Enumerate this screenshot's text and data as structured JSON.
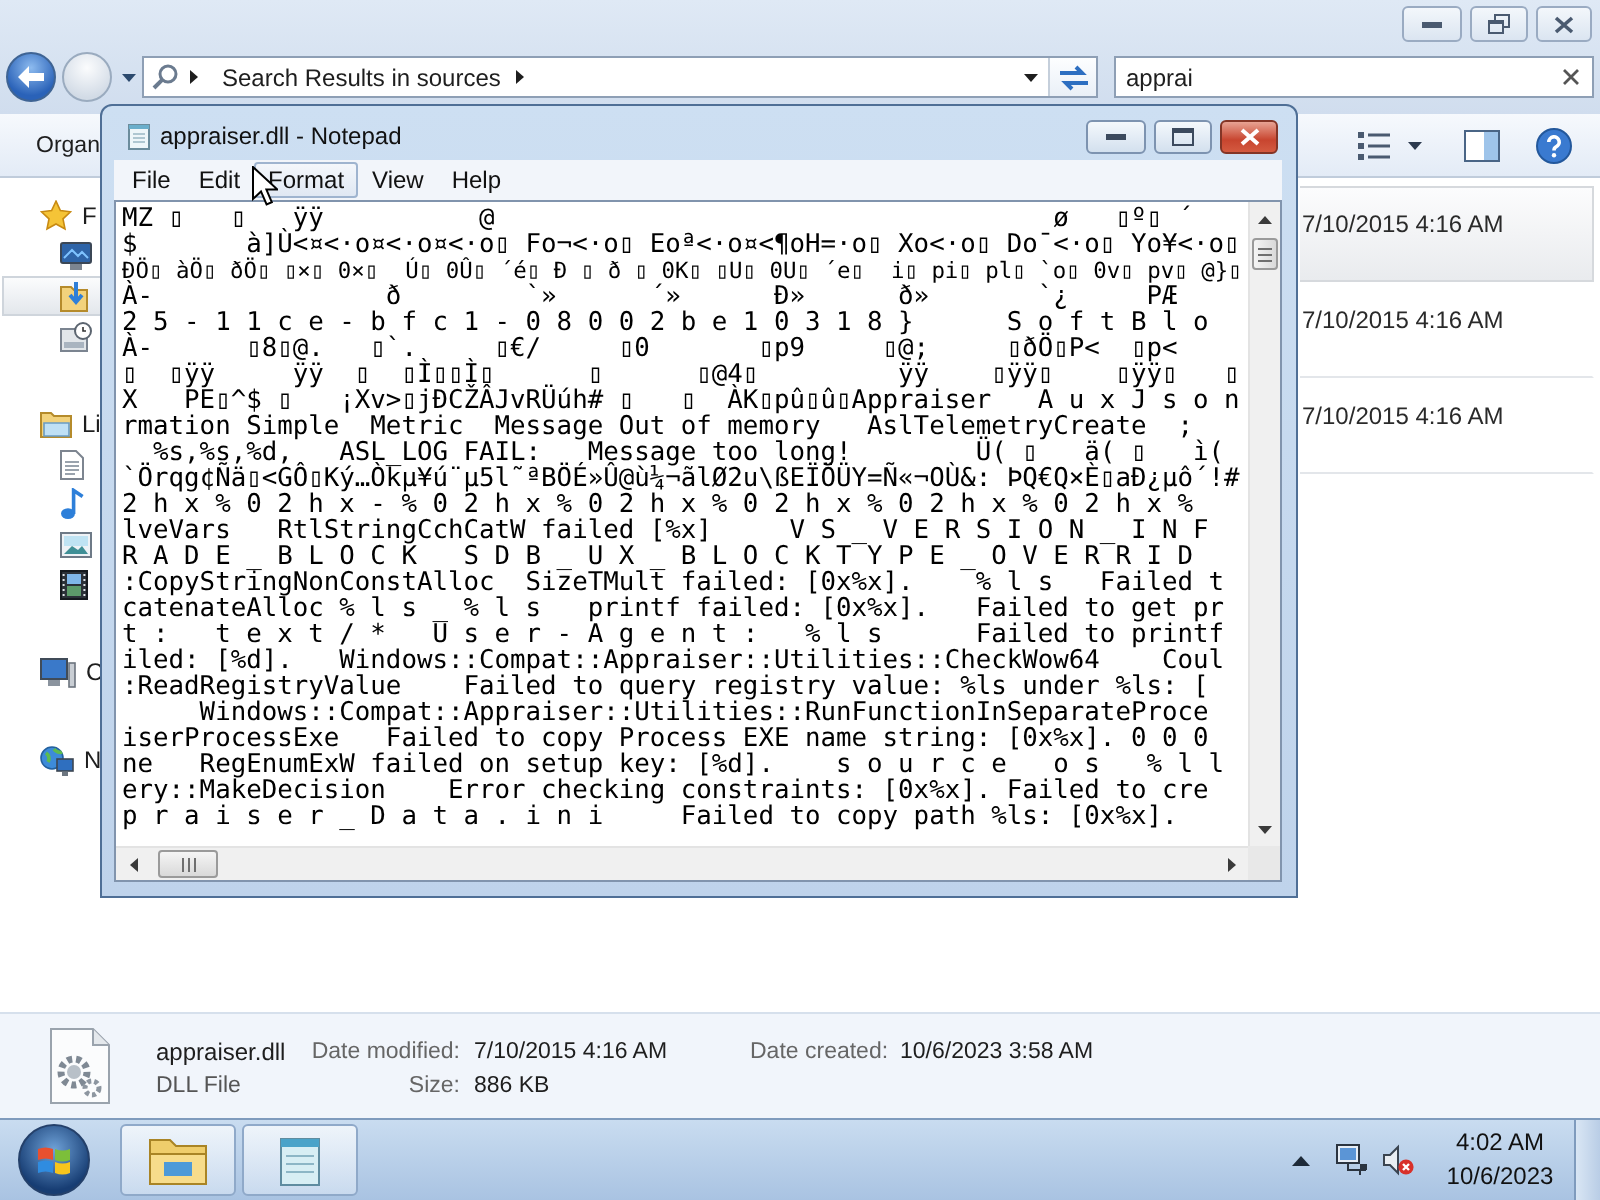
{
  "explorer": {
    "nav_buttons": [
      {
        "kind": "back",
        "disabled": false
      },
      {
        "kind": "forward",
        "disabled": true
      }
    ],
    "address_bar": {
      "path": "Search Results in sources"
    },
    "search": {
      "value": "apprai"
    },
    "toolbar": {
      "menu_label": "Organ"
    },
    "nav_pane": [
      {
        "label": "F",
        "selected": false,
        "children": [
          {
            "selected": false
          },
          {
            "selected": true
          },
          {
            "selected": false
          }
        ]
      },
      {
        "label": "Li",
        "selected": false,
        "children": [
          {
            "selected": false
          },
          {
            "selected": false
          },
          {
            "selected": false
          },
          {
            "selected": false
          }
        ]
      },
      {
        "label": "C",
        "selected": false
      },
      {
        "label": "N",
        "selected": false
      }
    ],
    "results": [
      {
        "date_modified": "7/10/2015 4:16 AM",
        "selected": true
      },
      {
        "date_modified": "7/10/2015 4:16 AM",
        "selected": false
      },
      {
        "date_modified": "7/10/2015 4:16 AM",
        "selected": false
      }
    ],
    "details_pane": {
      "name": "appraiser.dll",
      "type": "DLL File",
      "properties": [
        {
          "label": "Date modified:",
          "value": "7/10/2015 4:16 AM"
        },
        {
          "label": "Date created:",
          "value": "10/6/2023 3:58 AM"
        },
        {
          "label": "Size:",
          "value": "886 KB"
        }
      ]
    }
  },
  "notepad": {
    "title": "appraiser.dll - Notepad",
    "menu": [
      {
        "label": "File",
        "highlighted": false
      },
      {
        "label": "Edit",
        "highlighted": false
      },
      {
        "label": "Format",
        "highlighted": true
      },
      {
        "label": "View",
        "highlighted": false
      },
      {
        "label": "Help",
        "highlighted": false
      }
    ],
    "lines": [
      "MZ ▯   ▯   ÿÿ          @                                    ø   ▯º▯ ´",
      "$       à]Ù<¤<·o¤<·o¤<·o▯ Fo¬<·o▯ Eoª<·o¤<¶oH=·o▯ Xo<·o▯ Do¯<·o▯ Yo¥<·o▯",
      "ÐÖ▯ àÖ▯ ðÖ▯ ▯×▯ 0×▯  Ú▯ 0Û▯ ´é▯ Ð ▯ ð ▯ 0K▯ ▯U▯ 0U▯ ´e▯  i▯ pi▯ pl▯ `o▯ 0v▯ pv▯ @}▯",
      "À-               ð        `»      ´»      Ð»      ð»       `¿     PÆ",
      "2 5 - 1 1 c e - b f c 1 - 0 8 0 0 2 b e 1 0 3 1 8 }      S o f t B l o",
      "À-      ▯8▯@.   ▯`.     ▯€/     ▯0       ▯p9     ▯@;     ▯ðÖ▯P<  ▯p<",
      "▯  ▯ÿÿ     ÿÿ  ▯  ▯Ì▯▯Ì▯      ▯      ▯@4▯         ÿÿ    ▯ÿÿ▯    ▯ÿÿ▯   ▯",
      "X   PE▯^$ ▯   ¡Xv>▯jÐCŽÂJvRÜúh# ▯   ▯  ÀK▯pû▯û▯Appraiser   A u x J s o n",
      "rmation Simple  Metric  Message Out of memory   AslTelemetryCreate  ;",
      "  %s,%s,%d,   ASL_LOG FAIL:   Message too long!        Ü( ▯   ä( ▯   ì(",
      "`Örqg¢Ñä▯<GÔ▯Ký…Òkµ¥ú¨µ5l˜ªBÖÉ»Û@ù¼¬ãlØ2u\\ßEÏÖÜY=Ñ«¬OÙ&: ÞQ€Q×È▯aÐ¿µô´!#",
      "2 h x % 0 2 h x - % 0 2 h x % 0 2 h x % 0 2 h x % 0 2 h x % 0 2 h x %",
      "lveVars   RtlStringCchCatW failed [%x]     V S _ V E R S I O N _ I N F",
      "R A D E _ B L O C K   S D B _ U X _ B L O C K T Y P E _ O V E R R I D",
      ":CopyStringNonConstAlloc  SizeTMult failed: [0x%x].    % l s   Failed t",
      "catenateAlloc % l s _ % l s   printf failed: [0x%x].   Failed to get pr",
      "t :   t e x t / *   U s e r - A g e n t :   % l s      Failed to printf",
      "iled: [%d].   Windows::Compat::Appraiser::Utilities::CheckWow64    Coul",
      ":ReadRegistryValue    Failed to query registry value: %ls under %ls: [",
      "     Windows::Compat::Appraiser::Utilities::RunFunctionInSeparateProce",
      "iserProcessExe   Failed to copy Process EXE name string: [0x%x]. 0 0 0",
      "ne   RegEnumExW failed on setup key: [%d].    s o u r c e   o s   % l l",
      "ery::MakeDecision    Error checking constraints: [0x%x]. Failed to cre",
      "p r a i s e r _ D a t a . i n i     Failed to copy path %ls: [0x%x]."
    ]
  },
  "taskbar": {
    "clock": {
      "time": "4:02 AM",
      "date": "10/6/2023"
    }
  }
}
